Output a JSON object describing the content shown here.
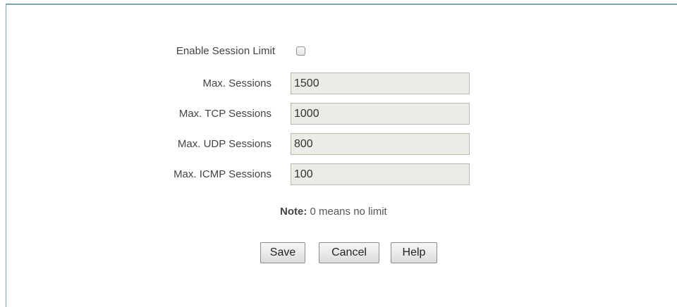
{
  "form": {
    "enable_session_limit_label": "Enable Session Limit",
    "enable_session_limit_checked": false,
    "max_sessions_label": "Max. Sessions",
    "max_sessions_value": "1500",
    "max_tcp_sessions_label": "Max. TCP Sessions",
    "max_tcp_sessions_value": "1000",
    "max_udp_sessions_label": "Max. UDP Sessions",
    "max_udp_sessions_value": "800",
    "max_icmp_sessions_label": "Max. ICMP Sessions",
    "max_icmp_sessions_value": "100",
    "note_prefix": "Note:",
    "note_text": " 0 means no limit"
  },
  "buttons": {
    "save_label": "Save",
    "cancel_label": "Cancel",
    "help_label": "Help"
  },
  "colors": {
    "frame_border": "#7aa6b2",
    "field_background": "#ecebe6"
  }
}
